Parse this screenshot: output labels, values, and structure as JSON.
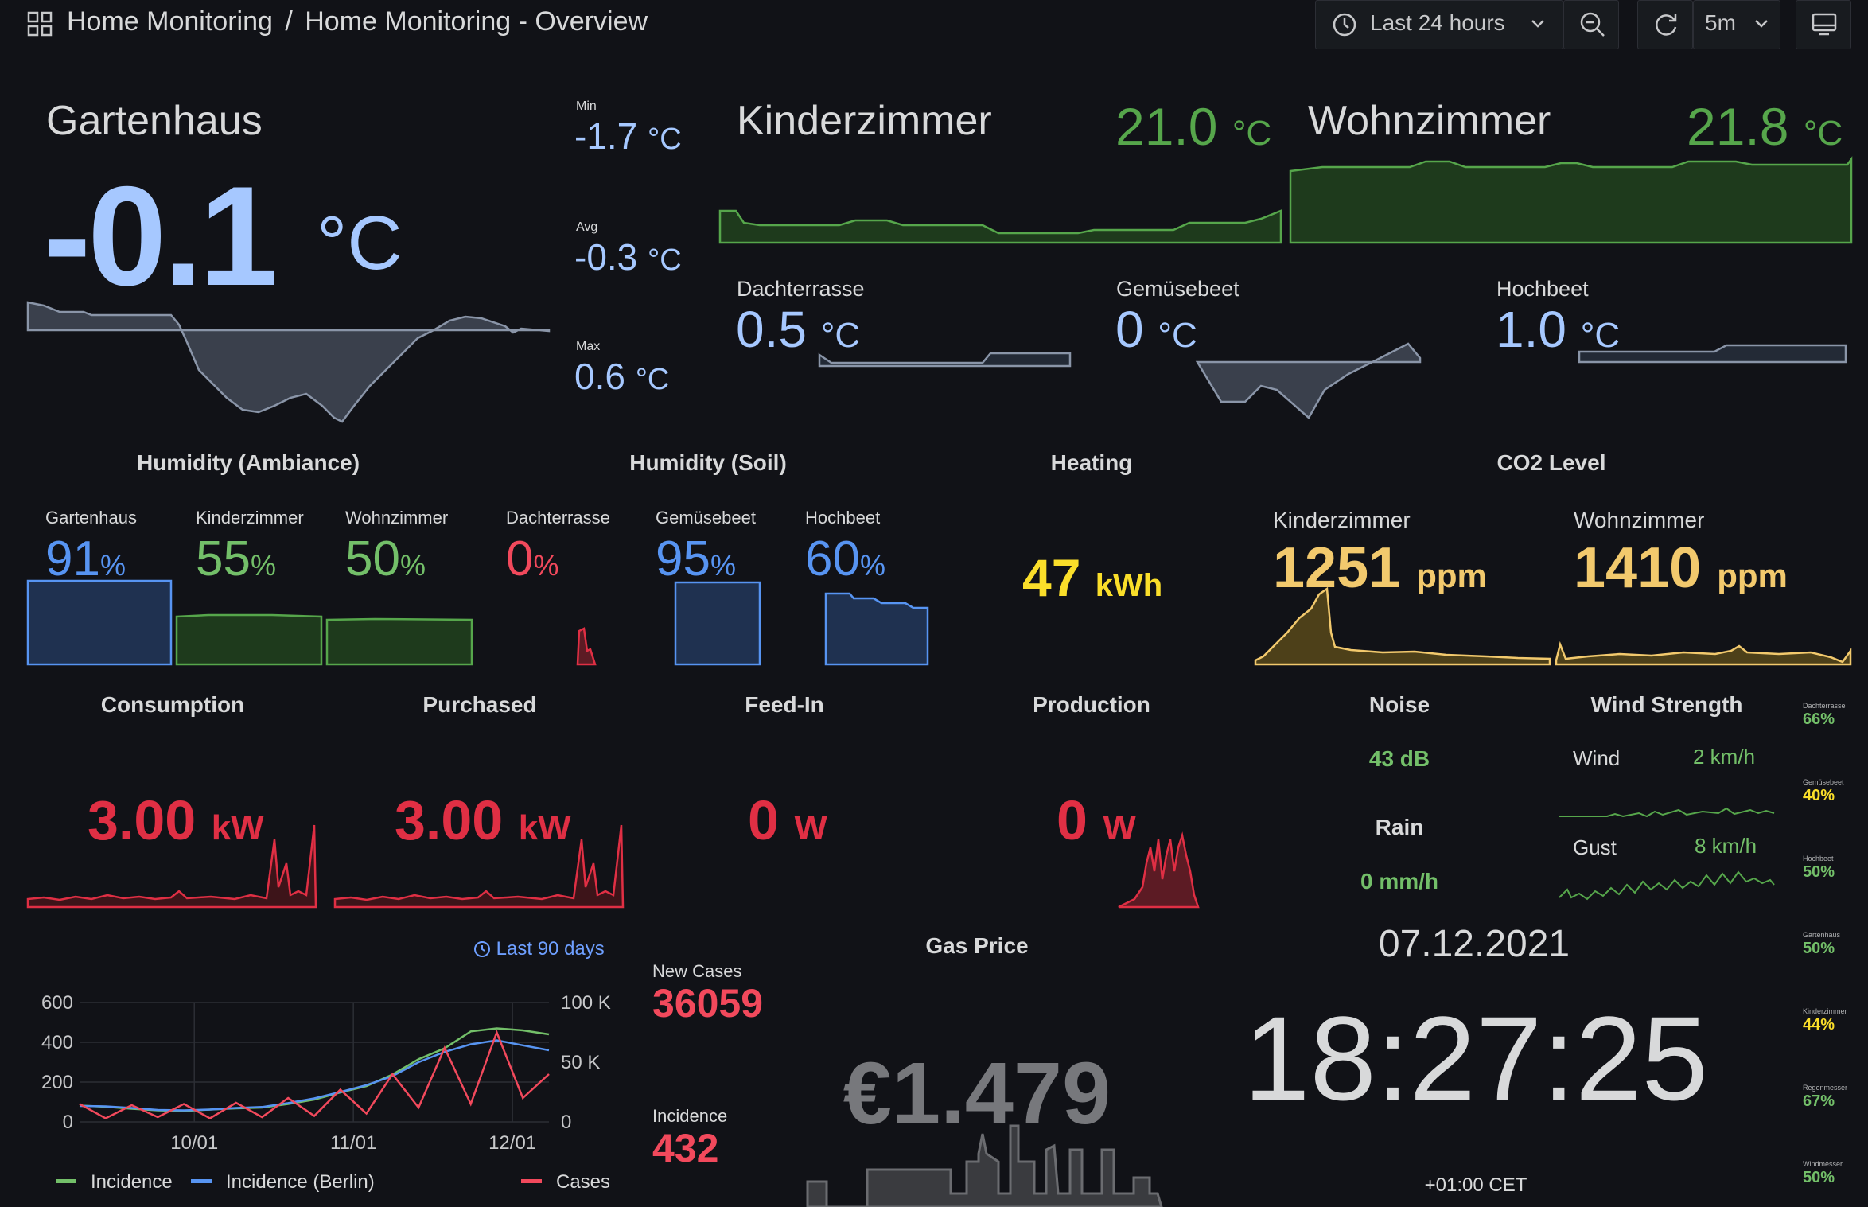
{
  "header": {
    "breadcrumb_folder": "Home Monitoring",
    "breadcrumb_separator": "/",
    "breadcrumb_dashboard": "Home Monitoring - Overview",
    "time_range": "Last 24 hours",
    "refresh_interval": "5m"
  },
  "gartenhaus": {
    "title": "Gartenhaus",
    "value": "-0.1",
    "unit": "°C",
    "min_label": "Min",
    "min_value": "-1.7",
    "min_unit": "°C",
    "avg_label": "Avg",
    "avg_value": "-0.3",
    "avg_unit": "°C",
    "max_label": "Max",
    "max_value": "0.6",
    "max_unit": "°C"
  },
  "kinderzimmer": {
    "title": "Kinderzimmer",
    "value": "21.0",
    "unit": "°C"
  },
  "wohnzimmer": {
    "title": "Wohnzimmer",
    "value": "21.8",
    "unit": "°C"
  },
  "dachterrasse": {
    "title": "Dachterrasse",
    "value": "0.5",
    "unit": "°C"
  },
  "gemuesebeet": {
    "title": "Gemüsebeet",
    "value": "0",
    "unit": "°C"
  },
  "hochbeet": {
    "title": "Hochbeet",
    "value": "1.0",
    "unit": "°C"
  },
  "humidity_ambiance": {
    "title": "Humidity (Ambiance)",
    "items": [
      {
        "name": "Gartenhaus",
        "value": "91",
        "unit": "%"
      },
      {
        "name": "Kinderzimmer",
        "value": "55",
        "unit": "%"
      },
      {
        "name": "Wohnzimmer",
        "value": "50",
        "unit": "%"
      },
      {
        "name": "Dachterrasse",
        "value": "0",
        "unit": "%"
      }
    ]
  },
  "humidity_soil": {
    "title": "Humidity (Soil)",
    "items": [
      {
        "name": "Gemüsebeet",
        "value": "95",
        "unit": "%"
      },
      {
        "name": "Hochbeet",
        "value": "60",
        "unit": "%"
      }
    ]
  },
  "heating": {
    "title": "Heating",
    "value": "47",
    "unit": "kWh"
  },
  "co2": {
    "title": "CO2 Level",
    "items": [
      {
        "name": "Kinderzimmer",
        "value": "1251",
        "unit": "ppm"
      },
      {
        "name": "Wohnzimmer",
        "value": "1410",
        "unit": "ppm"
      }
    ]
  },
  "power": {
    "consumption": {
      "title": "Consumption",
      "value": "3.00",
      "unit": "kW"
    },
    "purchased": {
      "title": "Purchased",
      "value": "3.00",
      "unit": "kW"
    },
    "feed_in": {
      "title": "Feed-In",
      "value": "0",
      "unit": "W"
    },
    "production": {
      "title": "Production",
      "value": "0",
      "unit": "W"
    }
  },
  "noise": {
    "title": "Noise",
    "value": "43 dB"
  },
  "rain": {
    "title": "Rain",
    "value": "0 mm/h"
  },
  "wind": {
    "title": "Wind Strength",
    "wind_label": "Wind",
    "wind_value": "2 km/h",
    "gust_label": "Gust",
    "gust_value": "8 km/h"
  },
  "battery": [
    {
      "name": "Dachterrasse",
      "value": "66%"
    },
    {
      "name": "Gemüsebeet",
      "value": "40%"
    },
    {
      "name": "Hochbeet",
      "value": "50%"
    },
    {
      "name": "Gartenhaus",
      "value": "50%"
    },
    {
      "name": "Kinderzimmer",
      "value": "44%"
    },
    {
      "name": "Regenmesser",
      "value": "67%"
    },
    {
      "name": "Windmesser",
      "value": "50%"
    }
  ],
  "covid": {
    "time_override": "Last 90 days",
    "new_cases_label": "New Cases",
    "new_cases_value": "36059",
    "incidence_label": "Incidence",
    "incidence_value": "432"
  },
  "gas": {
    "title": "Gas Price",
    "value": "€1.479"
  },
  "clock": {
    "date": "07.12.2021",
    "time": "18:27:25",
    "timezone": "+01:00 CET"
  },
  "chart_data": {
    "type": "line",
    "x_ticks": [
      "10/01",
      "11/01",
      "12/01"
    ],
    "y_left_ticks": [
      "600",
      "400",
      "200",
      "0"
    ],
    "y_right_ticks": [
      "100 K",
      "50 K",
      "0"
    ],
    "ylim_left": [
      0,
      600
    ],
    "ylim_right": [
      0,
      100000
    ],
    "grid": true,
    "legend_position": "bottom",
    "x": [
      "09/09",
      "09/14",
      "09/19",
      "09/24",
      "09/29",
      "10/04",
      "10/09",
      "10/14",
      "10/19",
      "10/24",
      "10/29",
      "11/03",
      "11/08",
      "11/13",
      "11/18",
      "11/23",
      "11/28",
      "12/03",
      "12/07"
    ],
    "series": [
      {
        "name": "Incidence",
        "axis": "left",
        "color": "#73bf69",
        "values": [
          82,
          76,
          66,
          58,
          55,
          62,
          68,
          72,
          90,
          112,
          148,
          180,
          238,
          315,
          370,
          455,
          470,
          460,
          440
        ]
      },
      {
        "name": "Incidence (Berlin)",
        "axis": "left",
        "color": "#5794f2",
        "values": [
          80,
          78,
          70,
          60,
          58,
          62,
          70,
          75,
          95,
          118,
          150,
          185,
          230,
          300,
          352,
          390,
          410,
          385,
          360
        ]
      },
      {
        "name": "Cases",
        "axis": "right",
        "color": "#f2495c",
        "values": [
          15000,
          3000,
          14000,
          4000,
          15000,
          3000,
          16000,
          4000,
          20000,
          5000,
          27000,
          7000,
          40000,
          12000,
          62000,
          15000,
          75000,
          20000,
          40000
        ]
      }
    ]
  },
  "colors": {
    "background": "#111217",
    "temp_blue": "#a6c8ff",
    "green": "#56a64b",
    "red": "#e02f44",
    "yellow": "#fade2a",
    "orange": "#f2c96d",
    "panel_link_blue": "#5794f2"
  },
  "icons": [
    "grid-icon",
    "clock-icon",
    "chevron-down-icon",
    "zoom-out-icon",
    "refresh-icon",
    "tv-icon"
  ]
}
